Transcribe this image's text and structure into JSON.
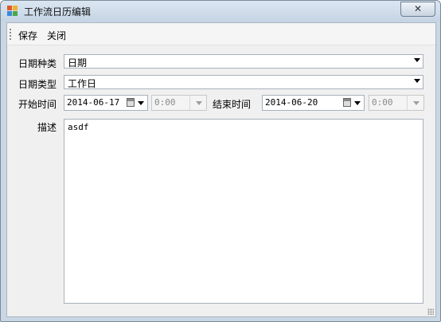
{
  "window": {
    "title": "工作流日历编辑",
    "close_glyph": "✕"
  },
  "toolbar": {
    "save_label": "保存",
    "close_label": "关闭"
  },
  "form": {
    "date_kind_label": "日期种类",
    "date_kind_value": "日期",
    "date_type_label": "日期类型",
    "date_type_value": "工作日",
    "start_label": "开始时间",
    "start_date": "2014-06-17",
    "start_time": "0:00",
    "end_label": "结束时间",
    "end_date": "2014-06-20",
    "end_time": "0:00",
    "desc_label": "描述",
    "desc_value": "asdf"
  },
  "icons": {
    "app": "calendar-app-icon",
    "calendar": "calendar-icon",
    "dropdown": "chevron-down-icon"
  }
}
